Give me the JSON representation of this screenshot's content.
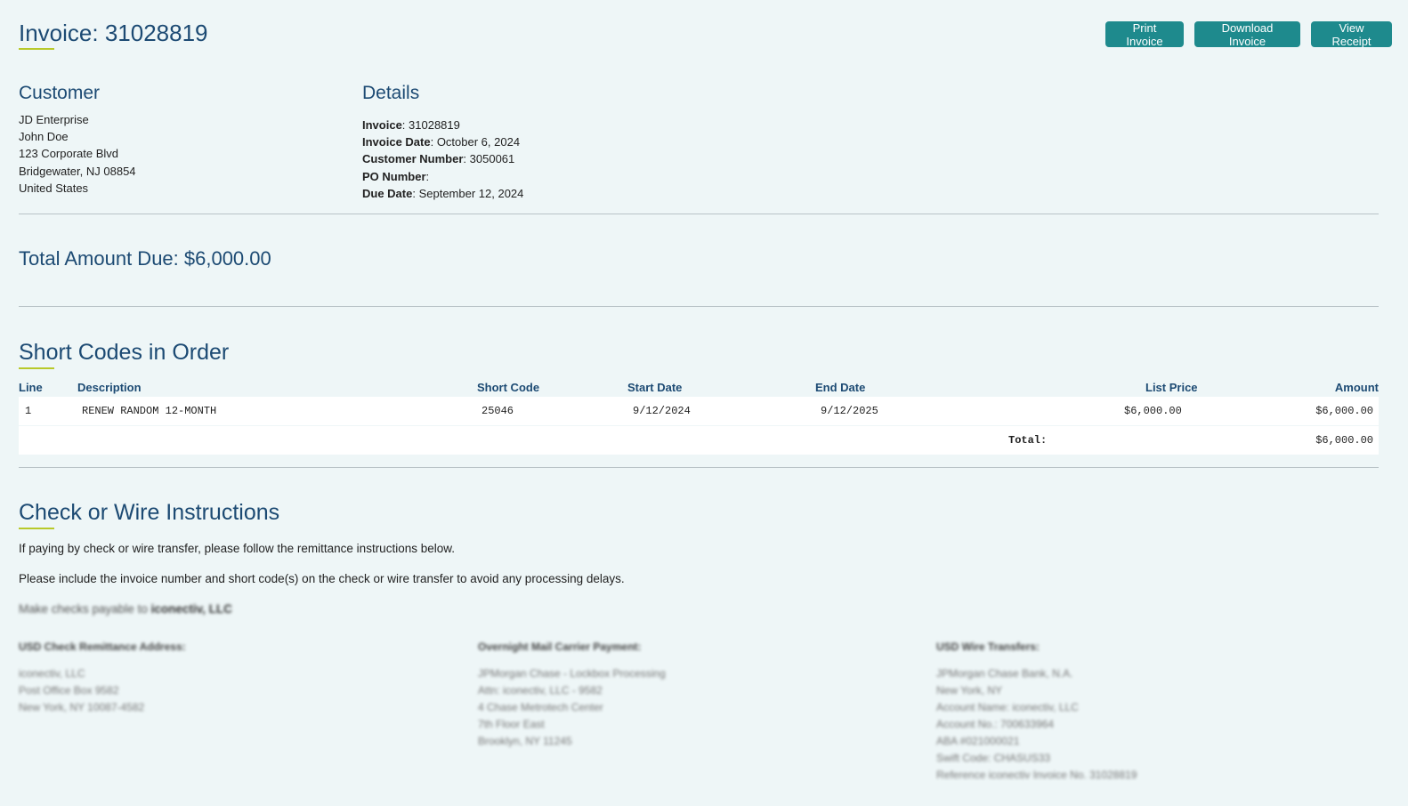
{
  "header": {
    "title": "Invoice: 31028819",
    "buttons": {
      "print": "Print Invoice",
      "download": "Download Invoice",
      "receipt": "View Receipt"
    }
  },
  "customer": {
    "heading": "Customer",
    "lines": [
      "JD Enterprise",
      "John Doe",
      "123 Corporate Blvd",
      "Bridgewater, NJ 08854",
      "United States"
    ]
  },
  "details": {
    "heading": "Details",
    "invoice_label": "Invoice",
    "invoice_value": ": 31028819",
    "invoice_date_label": "Invoice Date",
    "invoice_date_value": ": October 6, 2024",
    "customer_number_label": "Customer Number",
    "customer_number_value": ": 3050061",
    "po_number_label": "PO Number",
    "po_number_value": ":",
    "due_date_label": "Due Date",
    "due_date_value": ": September 12, 2024"
  },
  "total_due": "Total Amount Due: $6,000.00",
  "short_codes": {
    "heading": "Short Codes in Order",
    "columns": {
      "line": "Line",
      "description": "Description",
      "short_code": "Short Code",
      "start_date": "Start Date",
      "end_date": "End Date",
      "list_price": "List Price",
      "amount": "Amount"
    },
    "rows": [
      {
        "line": "1",
        "description": "RENEW RANDOM 12-MONTH",
        "short_code": "25046",
        "start_date": "9/12/2024",
        "end_date": "9/12/2025",
        "list_price": "$6,000.00",
        "amount": "$6,000.00"
      }
    ],
    "total_label": "Total:",
    "total_value": "$6,000.00"
  },
  "instructions": {
    "heading": "Check or Wire Instructions",
    "para1": "If paying by check or wire transfer, please follow the remittance instructions below.",
    "para2": "Please include the invoice number and short code(s) on the check or wire transfer to avoid any processing delays.",
    "payable_prefix": "Make checks payable to ",
    "payable_name": "iconectiv, LLC",
    "check": {
      "heading": "USD Check Remittance Address:",
      "lines": [
        "iconectiv, LLC",
        "Post Office Box 9582",
        "New York, NY 10087-4582"
      ]
    },
    "overnight": {
      "heading": "Overnight Mail Carrier Payment:",
      "lines": [
        "JPMorgan Chase - Lockbox Processing",
        "Attn: iconectiv, LLC - 9582",
        "4 Chase Metrotech Center",
        "7th Floor East",
        "Brooklyn, NY 11245"
      ]
    },
    "wire": {
      "heading": "USD Wire Transfers:",
      "lines": [
        "JPMorgan Chase Bank, N.A.",
        "New York, NY",
        "Account Name: iconectiv, LLC",
        "Account No.: 700633964",
        "ABA #021000021",
        "Swift Code: CHASUS33",
        "Reference iconectiv Invoice No. 31028819"
      ]
    }
  },
  "colors": {
    "background": "#eef6f7",
    "heading": "#1c4a73",
    "button": "#1e8a8d",
    "accent": "#b8c92a"
  }
}
